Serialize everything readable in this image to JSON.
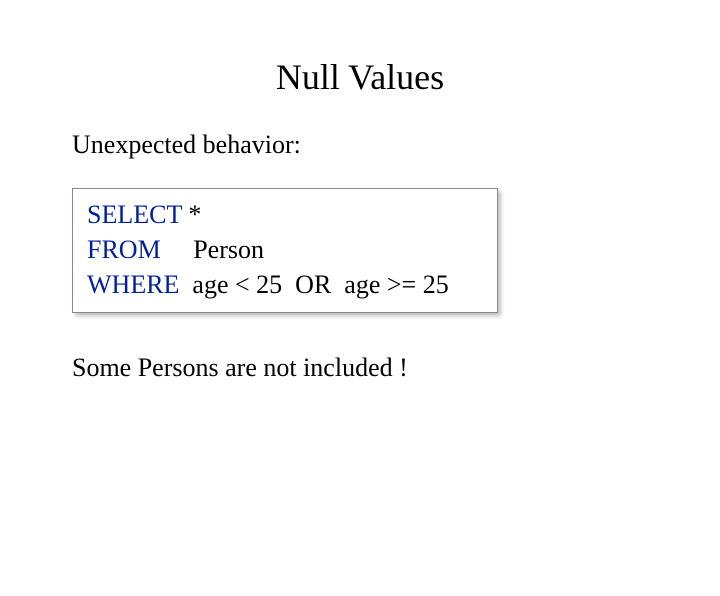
{
  "title": "Null Values",
  "lead": "Unexpected behavior:",
  "sql": {
    "kw_select": "SELECT",
    "select_rest": " *",
    "kw_from": "FROM",
    "from_rest": "     Person",
    "kw_where": "WHERE",
    "where_rest": "  age < 25  OR  age >= 25"
  },
  "follow": "Some Persons are not included !"
}
